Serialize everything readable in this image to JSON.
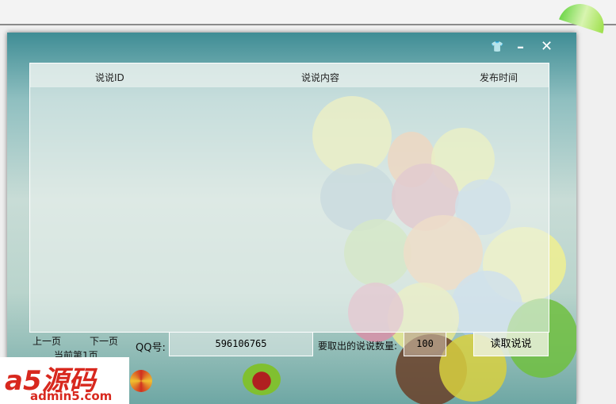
{
  "window": {
    "controls": [
      "skin-icon",
      "minimize-icon",
      "close-icon"
    ]
  },
  "table": {
    "columns": [
      "说说ID",
      "说说内容",
      "发布时间"
    ],
    "rows": []
  },
  "pager": {
    "prev": "上一页",
    "next": "下一页",
    "current": "当前第1页"
  },
  "form": {
    "qq_label": "QQ号:",
    "qq_value": "596106765",
    "count_label": "要取出的说说数量:",
    "count_value": "100",
    "read_button": "读取说说"
  },
  "watermark": {
    "brand": "a5源码",
    "url": "admin5.com"
  }
}
